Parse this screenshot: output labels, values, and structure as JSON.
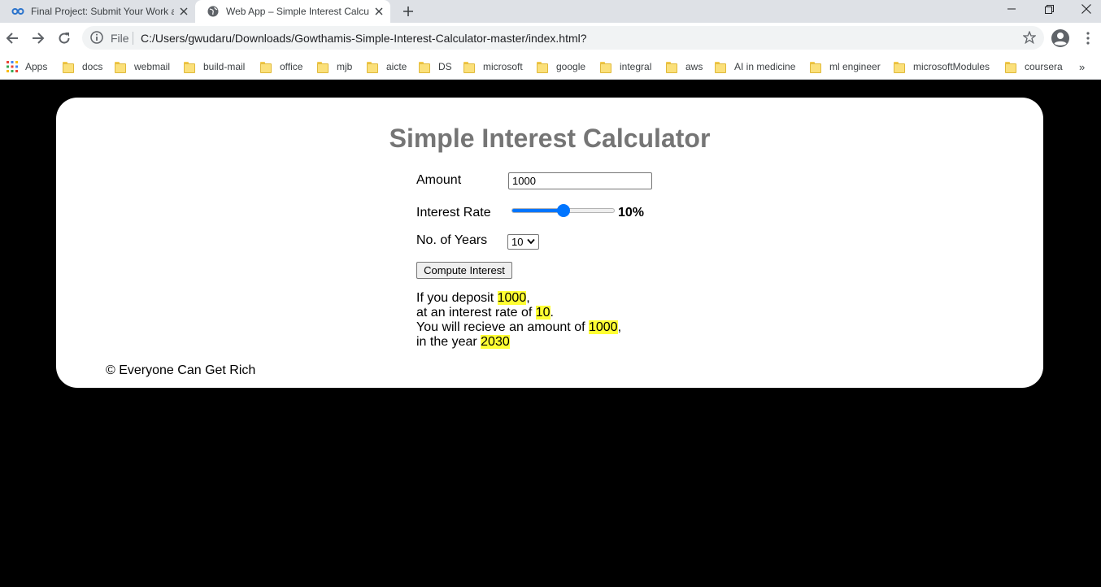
{
  "browser": {
    "tabs": [
      {
        "title": "Final Project: Submit Your Work a",
        "icon": "coursera-icon"
      },
      {
        "title": "Web App – Simple Interest Calcul",
        "icon": "globe-icon"
      }
    ],
    "address": {
      "scheme": "File",
      "url": "C:/Users/gwudaru/Downloads/Gowthamis-Simple-Interest-Calculator-master/index.html?"
    },
    "bookmarks": [
      "Apps",
      "docs",
      "webmail",
      "build-mail",
      "office",
      "mjb",
      "aicte",
      "DS",
      "microsoft",
      "google",
      "integral",
      "aws",
      "AI in medicine",
      "ml engineer",
      "microsoftModules",
      "coursera"
    ],
    "bookmarks_overflow": "»"
  },
  "page": {
    "title": "Simple Interest Calculator",
    "amount_label": "Amount",
    "amount_value": "1000",
    "rate_label": "Interest Rate",
    "rate_display": "10%",
    "rate_fraction": 0.5,
    "years_label": "No. of Years",
    "years_value": "10",
    "compute_label": "Compute Interest",
    "result": {
      "line1_prefix": "If you deposit ",
      "deposit": "1000",
      "line1_suffix": ",",
      "line2_prefix": "at an interest rate of ",
      "rate": "10",
      "line2_suffix": ".",
      "line3_prefix": "You will recieve an amount of ",
      "amount": "1000",
      "line3_suffix": ",",
      "line4_prefix": "in the year ",
      "year": "2030"
    },
    "footer": "© Everyone Can Get Rich"
  },
  "colors": {
    "accent": "#0075ff",
    "highlight": "#ffff33",
    "heading": "#757575",
    "background": "#000000"
  }
}
